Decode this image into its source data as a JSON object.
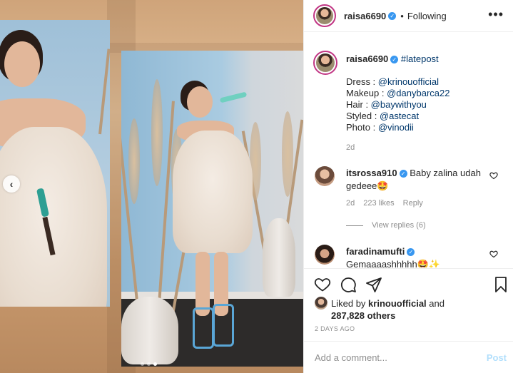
{
  "post": {
    "username": "raisa6690",
    "separator": "•",
    "follow_status": "Following",
    "more_label": "•••"
  },
  "caption": {
    "username": "raisa6690",
    "hashtag": "#latepost",
    "lines": [
      {
        "label": "Dress : ",
        "handle": "@krinouofficial"
      },
      {
        "label": "Makeup : ",
        "handle": "@danybarca22"
      },
      {
        "label": "Hair : ",
        "handle": "@baywithyou"
      },
      {
        "label": "Styled : ",
        "handle": "@astecat"
      },
      {
        "label": "Photo : ",
        "handle": "@vinodii"
      }
    ],
    "age": "2d"
  },
  "comments": [
    {
      "username": "itsrossa910",
      "text": "Baby zalina udah gedeee🤩",
      "age": "2d",
      "likes": "223 likes",
      "reply_label": "Reply",
      "view_replies": "View replies (6)"
    },
    {
      "username": "faradinamufti",
      "text": "Gemaaaashhhhh🤩✨"
    }
  ],
  "liked_by": {
    "prefix": "Liked by ",
    "user": "krinouofficial",
    "middle": " and",
    "count": "287,828",
    "suffix": " others"
  },
  "date": "2 DAYS AGO",
  "add_comment": {
    "placeholder": "Add a comment...",
    "post_label": "Post"
  },
  "carousel": {
    "prev_glyph": "‹",
    "slides": 3,
    "active_slide": 3
  },
  "colors": {
    "link": "#00376b",
    "verified": "#3897f0",
    "muted": "#8e8e8e",
    "post_button": "#b2dffc"
  },
  "icons": [
    "heart-icon",
    "comment-icon",
    "share-icon",
    "bookmark-icon",
    "verified-badge-icon",
    "chevron-left-icon"
  ]
}
